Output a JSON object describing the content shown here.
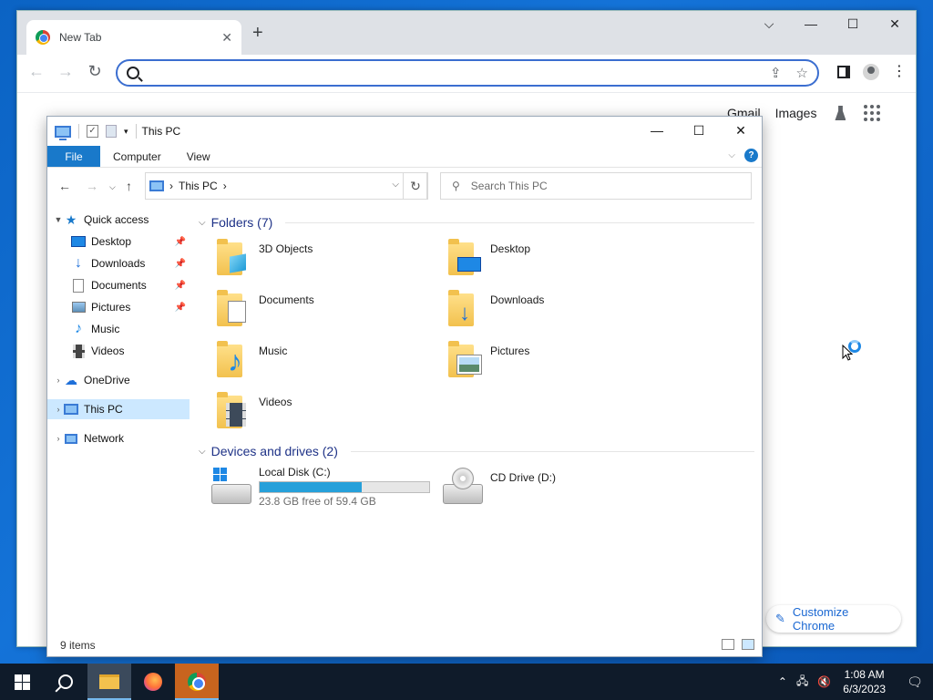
{
  "chrome": {
    "tab_title": "New Tab",
    "new_tab_icon": "+",
    "omnibox_value": "",
    "links": {
      "gmail": "Gmail",
      "images": "Images"
    },
    "customize_label": "Customize Chrome",
    "accent": "#3b6ed0"
  },
  "explorer": {
    "title": "This PC",
    "ribbon_tabs": [
      "File",
      "Computer",
      "View"
    ],
    "address": {
      "root": "This PC"
    },
    "search_placeholder": "Search This PC",
    "nav": {
      "quick_access": "Quick access",
      "items": [
        {
          "label": "Desktop",
          "pinned": true
        },
        {
          "label": "Downloads",
          "pinned": true
        },
        {
          "label": "Documents",
          "pinned": true
        },
        {
          "label": "Pictures",
          "pinned": true
        },
        {
          "label": "Music",
          "pinned": false
        },
        {
          "label": "Videos",
          "pinned": false
        }
      ],
      "onedrive": "OneDrive",
      "this_pc": "This PC",
      "network": "Network"
    },
    "folders_header": "Folders (7)",
    "folders": [
      {
        "label": "3D Objects",
        "icon": "3d-objects-folder-icon"
      },
      {
        "label": "Desktop",
        "icon": "desktop-folder-icon"
      },
      {
        "label": "Documents",
        "icon": "documents-folder-icon"
      },
      {
        "label": "Downloads",
        "icon": "downloads-folder-icon"
      },
      {
        "label": "Music",
        "icon": "music-folder-icon"
      },
      {
        "label": "Pictures",
        "icon": "pictures-folder-icon"
      },
      {
        "label": "Videos",
        "icon": "videos-folder-icon"
      }
    ],
    "devices_header": "Devices and drives (2)",
    "drives": {
      "c_label": "Local Disk (C:)",
      "c_free": "23.8 GB free of 59.4 GB",
      "c_used_fraction": 0.6,
      "d_label": "CD Drive (D:)"
    },
    "status": "9 items",
    "accent": "#1979ca"
  },
  "taskbar": {
    "time": "1:08 AM",
    "date": "6/3/2023"
  }
}
